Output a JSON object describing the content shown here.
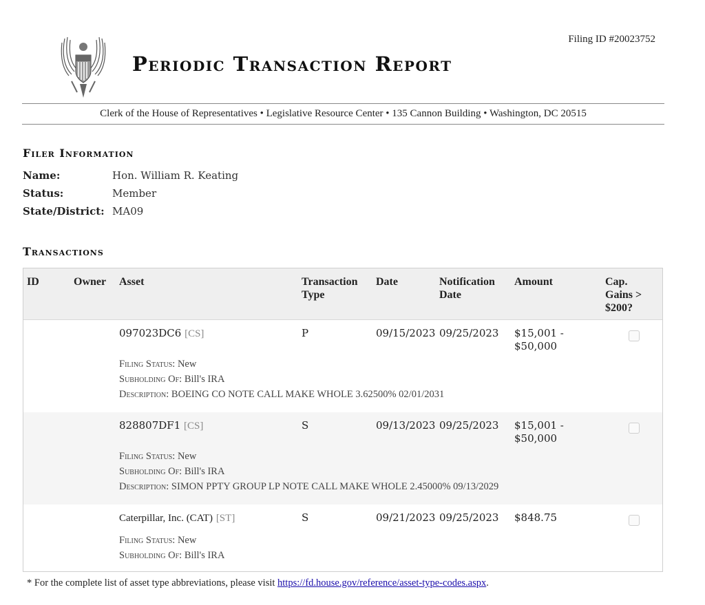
{
  "header": {
    "title": "Periodic Transaction Report",
    "filing_id": "Filing ID #20023752",
    "address": "Clerk of the House of Representatives • Legislative Resource Center • 135 Cannon Building • Washington, DC 20515",
    "seal_icon": "eagle-seal-icon"
  },
  "filer": {
    "heading": "Filer Information",
    "name_label": "Name:",
    "name_value": "Hon. William R. Keating",
    "status_label": "Status:",
    "status_value": "Member",
    "state_label": "State/District:",
    "state_value": "MA09"
  },
  "transactions": {
    "heading": "Transactions",
    "columns": {
      "id": "ID",
      "owner": "Owner",
      "asset": "Asset",
      "ttype_1": "Transaction",
      "ttype_2": "Type",
      "date": "Date",
      "notif_1": "Notification",
      "notif_2": "Date",
      "amount": "Amount",
      "cap_1": "Cap.",
      "cap_2": "Gains >",
      "cap_3": "$200?"
    },
    "rows": [
      {
        "id": "",
        "owner": "",
        "asset": "097023DC6",
        "asset_type": "[CS]",
        "type": "P",
        "date": "09/15/2023",
        "notification_date": "09/25/2023",
        "amount_1": "$15,001 -",
        "amount_2": "$50,000",
        "cap_gains": false,
        "filing_status_label": "Filing Status:",
        "filing_status": "New",
        "subholding_label": "Subholding Of:",
        "subholding": "Bill's IRA",
        "description_label": "Description:",
        "description": "BOEING CO NOTE CALL MAKE WHOLE 3.62500% 02/01/2031"
      },
      {
        "id": "",
        "owner": "",
        "asset": "828807DF1",
        "asset_type": "[CS]",
        "type": "S",
        "date": "09/13/2023",
        "notification_date": "09/25/2023",
        "amount_1": "$15,001 -",
        "amount_2": "$50,000",
        "cap_gains": false,
        "filing_status_label": "Filing Status:",
        "filing_status": "New",
        "subholding_label": "Subholding Of:",
        "subholding": "Bill's IRA",
        "description_label": "Description:",
        "description": "SIMON PPTY GROUP LP NOTE CALL MAKE WHOLE 2.45000% 09/13/2029"
      },
      {
        "id": "",
        "owner": "",
        "asset": "Caterpillar, Inc. (CAT)",
        "asset_type": "[ST]",
        "type": "S",
        "date": "09/21/2023",
        "notification_date": "09/25/2023",
        "amount_1": "$848.75",
        "amount_2": "",
        "cap_gains": false,
        "filing_status_label": "Filing Status:",
        "filing_status": "New",
        "subholding_label": "Subholding Of:",
        "subholding": "Bill's IRA"
      }
    ]
  },
  "footnote": {
    "text": "* For the complete list of asset type abbreviations, please visit ",
    "link": "https://fd.house.gov/reference/asset-type-codes.aspx",
    "end": "."
  }
}
